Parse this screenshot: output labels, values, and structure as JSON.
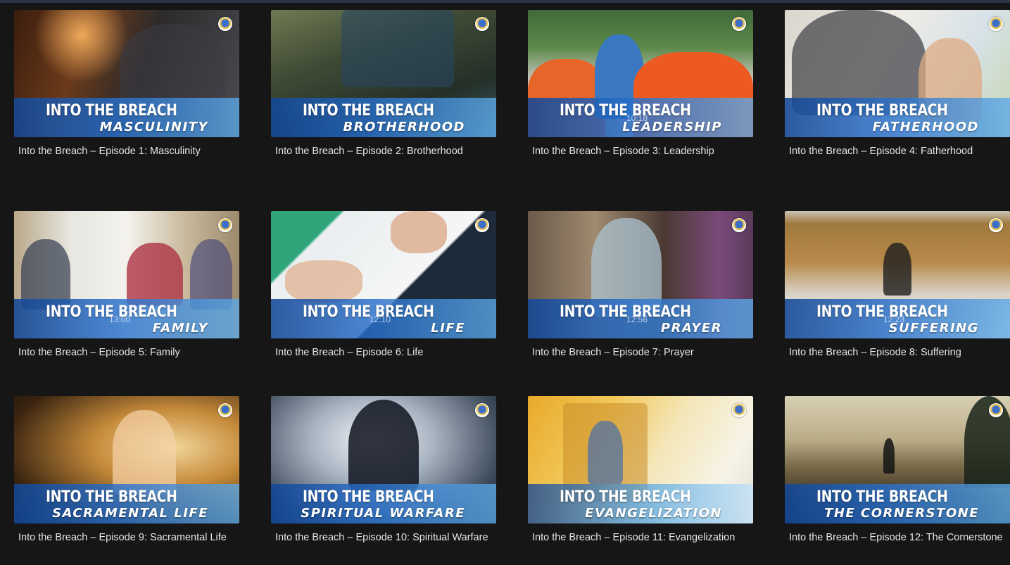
{
  "episodes": [
    {
      "banner_title": "INTO THE BREACH",
      "banner_subtitle": "MASCULINITY",
      "duration": "",
      "caption": "Into the Breach – Episode 1: Masculinity",
      "theme": "warm-dark"
    },
    {
      "banner_title": "INTO THE BREACH",
      "banner_subtitle": "BROTHERHOOD",
      "duration": "",
      "caption": "Into the Breach – Episode 2: Brotherhood",
      "theme": "workshop"
    },
    {
      "banner_title": "INTO THE BREACH",
      "banner_subtitle": "LEADERSHIP",
      "duration": "10:18",
      "caption": "Into the Breach – Episode 3: Leadership",
      "theme": "football"
    },
    {
      "banner_title": "INTO THE BREACH",
      "banner_subtitle": "FATHERHOOD",
      "duration": "",
      "caption": "Into the Breach – Episode 4: Fatherhood",
      "theme": "bright-home"
    },
    {
      "banner_title": "INTO THE BREACH",
      "banner_subtitle": "FAMILY",
      "duration": "13:00",
      "caption": "Into the Breach – Episode 5: Family",
      "theme": "dining"
    },
    {
      "banner_title": "INTO THE BREACH",
      "banner_subtitle": "LIFE",
      "duration": "12:10",
      "caption": "Into the Breach – Episode 6: Life",
      "theme": "sign"
    },
    {
      "banner_title": "INTO THE BREACH",
      "banner_subtitle": "PRAYER",
      "duration": "12:56",
      "caption": "Into the Breach – Episode 7: Prayer",
      "theme": "church"
    },
    {
      "banner_title": "INTO THE BREACH",
      "banner_subtitle": "SUFFERING",
      "duration": "12:23",
      "caption": "Into the Breach – Episode 8: Suffering",
      "theme": "doors"
    },
    {
      "banner_title": "INTO THE BREACH",
      "banner_subtitle": "SACRAMENTAL LIFE",
      "duration": "",
      "caption": "Into the Breach – Episode 9: Sacramental Life",
      "theme": "golden"
    },
    {
      "banner_title": "INTO THE BREACH",
      "banner_subtitle": "SPIRITUAL WARFARE",
      "duration": "",
      "caption": "Into the Breach – Episode 10: Spiritual Warfare",
      "theme": "angel"
    },
    {
      "banner_title": "INTO THE BREACH",
      "banner_subtitle": "EVANGELIZATION",
      "duration": "",
      "caption": "Into the Breach – Episode 11: Evangelization",
      "theme": "scripture"
    },
    {
      "banner_title": "INTO THE BREACH",
      "banner_subtitle": "THE CORNERSTONE",
      "duration": "",
      "caption": "Into the Breach – Episode 12: The Cornerstone",
      "theme": "sunrise"
    }
  ],
  "colors": {
    "page_background": "#161616",
    "banner_blue": "#276ec9",
    "caption_text": "#e6e6e6"
  },
  "icons": {
    "episode_emblem": "knights-of-columbus-emblem-icon"
  }
}
